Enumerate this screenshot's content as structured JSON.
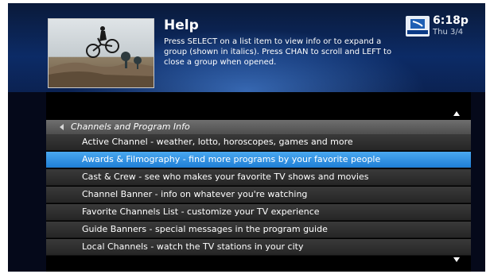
{
  "header": {
    "title": "Help",
    "instructions": "Press SELECT on a list item to view info or to expand a group (shown in italics). Press CHAN to scroll and LEFT to close a group when opened.",
    "logo_icon": "directv-logo-icon",
    "time": "6:18p",
    "date": "Thu 3/4"
  },
  "list": {
    "group_label": "Channels and Program Info",
    "items": [
      {
        "label": "Active Channel - weather, lotto, horoscopes, games and more"
      },
      {
        "label": "Awards & Filmography - find more programs by your favorite people"
      },
      {
        "label": "Cast & Crew - see who makes your favorite TV shows and movies"
      },
      {
        "label": "Channel Banner - info on whatever you're watching"
      },
      {
        "label": "Favorite Channels List - customize your TV experience"
      },
      {
        "label": "Guide Banners - special messages in the program guide"
      },
      {
        "label": "Local Channels - watch the TV stations in your city"
      }
    ],
    "selected_index": 1
  },
  "colors": {
    "selected_row": "#2b8fe4",
    "header_blue": "#0c2b66"
  }
}
